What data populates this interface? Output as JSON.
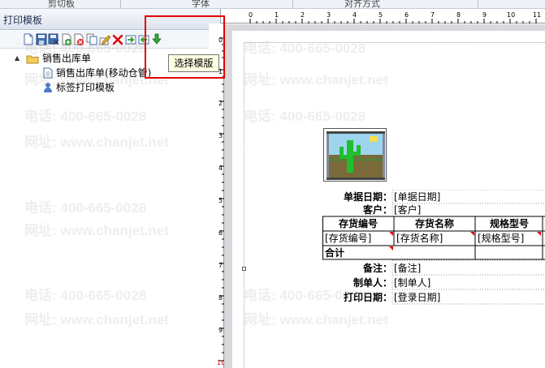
{
  "ribbon": {
    "groups": [
      "剪切板",
      "字体",
      "对齐方式"
    ]
  },
  "panel": {
    "title": "打印模板"
  },
  "toolbar": {
    "icons": [
      "new-icon",
      "save-icon",
      "save-as-icon",
      "add-icon",
      "delete-icon",
      "copy-icon",
      "edit-icon",
      "remove-icon",
      "import-icon",
      "export-icon",
      "select-template-icon"
    ]
  },
  "tree": {
    "root": "销售出库单",
    "children": [
      "销售出库单(移动仓管)",
      "标签打印模板"
    ]
  },
  "tooltip": "选择模版",
  "ruler": {
    "h": [
      "0",
      "1",
      "2",
      "3",
      "4",
      "5",
      "6",
      "7",
      "8",
      "9",
      "10",
      "11",
      "12",
      "13",
      "14",
      "15"
    ],
    "v": [
      "0",
      "1",
      "2",
      "3",
      "4",
      "5",
      "6",
      "7",
      "8",
      "9",
      "10"
    ]
  },
  "report": {
    "fields": [
      {
        "label": "单据日期：",
        "value": "[单据日期]"
      },
      {
        "label": "客户：",
        "value": "[客户]"
      }
    ],
    "table_headers": [
      "存货编号",
      "存货名称",
      "规格型号"
    ],
    "table_row": [
      "[存货编号]",
      "[存货名称]",
      "[规格型号]"
    ],
    "total_label": "合计",
    "footer_fields": [
      {
        "label": "备注：",
        "value": "[备注]"
      },
      {
        "label": "制单人：",
        "value": "[制单人]"
      },
      {
        "label": "打印日期：",
        "value": "[登录日期]"
      }
    ]
  },
  "watermark": {
    "phone": "电话: 400-665-0028",
    "site": "网址: www.chanjet.net"
  },
  "colors": {
    "highlight": "#e20000",
    "tooltip_bg": "#ffffe1",
    "marker": "#e30000"
  }
}
